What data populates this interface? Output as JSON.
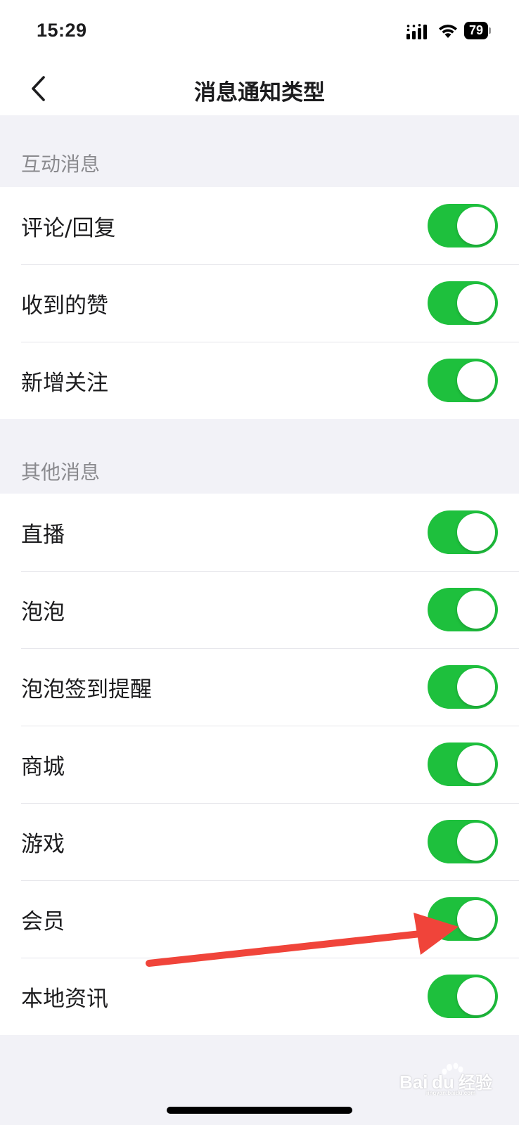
{
  "status_bar": {
    "time": "15:29",
    "battery": "79"
  },
  "nav": {
    "title": "消息通知类型",
    "back_icon": "chevron-left-icon"
  },
  "sections": [
    {
      "header": "互动消息",
      "items": [
        {
          "label": "评论/回复",
          "enabled": true
        },
        {
          "label": "收到的赞",
          "enabled": true
        },
        {
          "label": "新增关注",
          "enabled": true
        }
      ]
    },
    {
      "header": "其他消息",
      "items": [
        {
          "label": "直播",
          "enabled": true
        },
        {
          "label": "泡泡",
          "enabled": true
        },
        {
          "label": "泡泡签到提醒",
          "enabled": true
        },
        {
          "label": "商城",
          "enabled": true
        },
        {
          "label": "游戏",
          "enabled": true
        },
        {
          "label": "会员",
          "enabled": true
        },
        {
          "label": "本地资讯",
          "enabled": true
        }
      ]
    }
  ],
  "colors": {
    "toggle_on": "#1ec03d",
    "annotation_arrow": "#f0443a",
    "background": "#f2f2f7"
  },
  "watermark": {
    "brand": "Baidu",
    "text": "经验",
    "url": "jingyan.baidu.com"
  }
}
